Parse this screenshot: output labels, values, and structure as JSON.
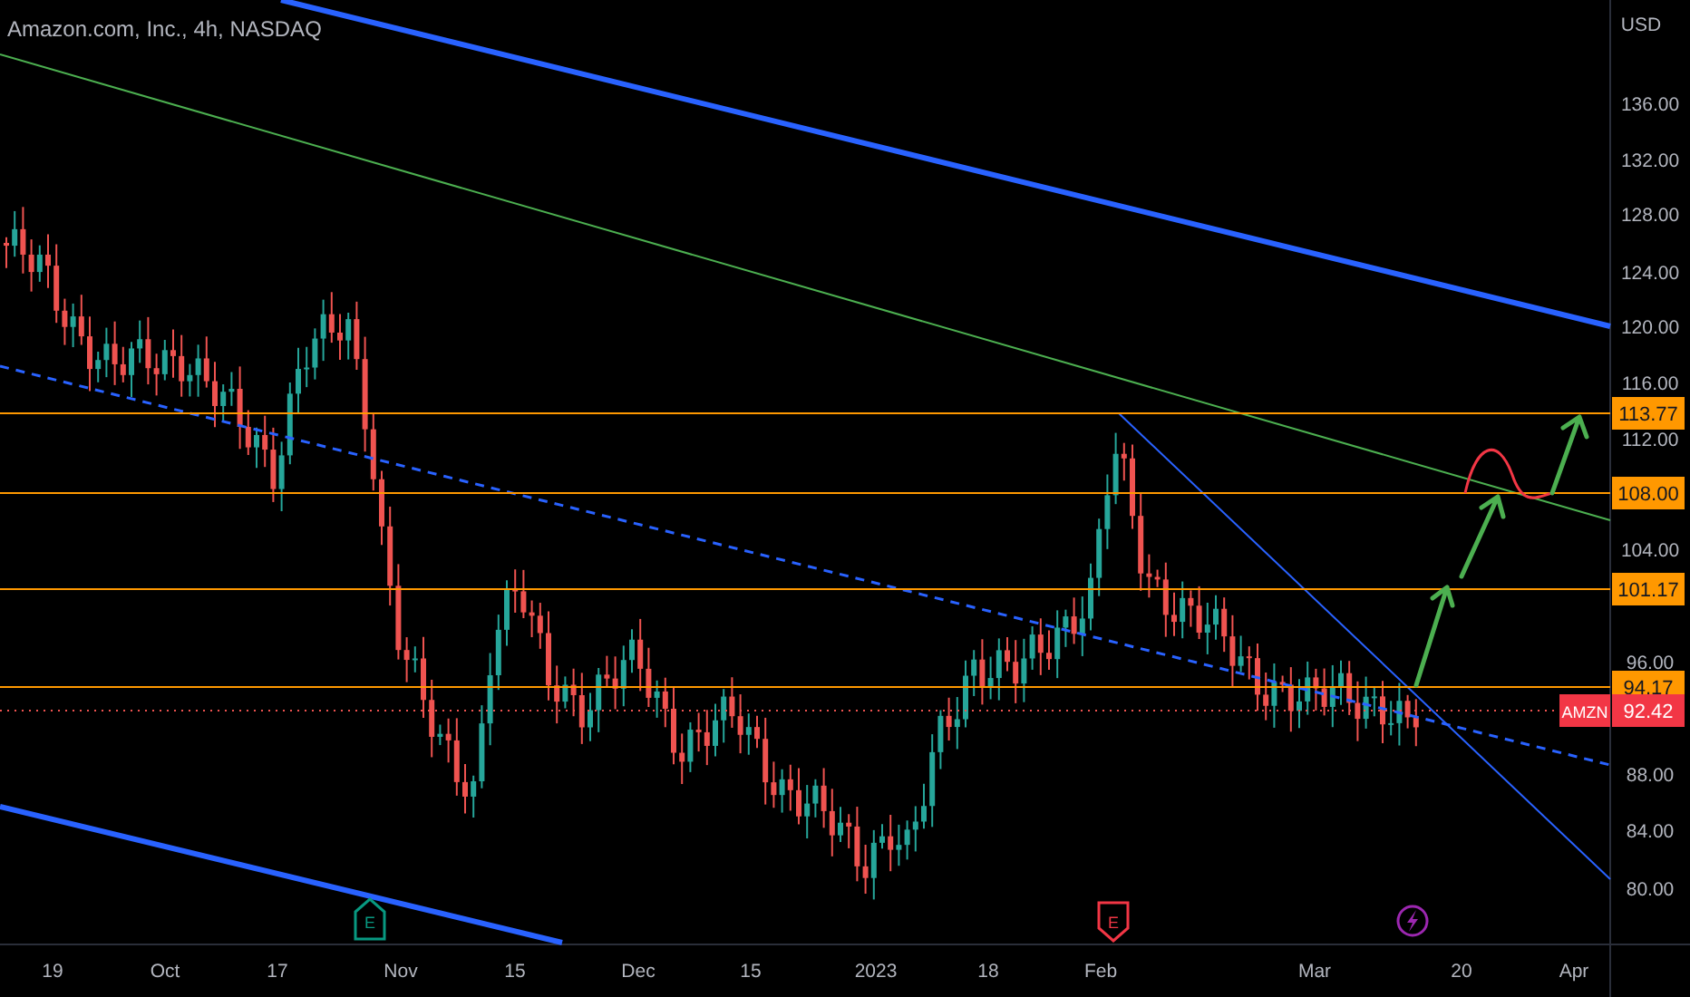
{
  "title": "Amazon.com, Inc., 4h, NASDAQ",
  "currency": "USD",
  "y_axis": [
    "136.00",
    "132.00",
    "128.00",
    "124.00",
    "120.00",
    "116.00",
    "112.00",
    "104.00",
    "96.00",
    "88.00",
    "84.00",
    "80.00"
  ],
  "x_axis": [
    "19",
    "Oct",
    "17",
    "Nov",
    "15",
    "Dec",
    "15",
    "2023",
    "18",
    "Feb",
    "Mar",
    "20",
    "Apr"
  ],
  "price_levels": [
    {
      "label": "113.77"
    },
    {
      "label": "108.00"
    },
    {
      "label": "101.17"
    },
    {
      "label": "94.17"
    }
  ],
  "current_price": {
    "symbol": "AMZN",
    "price": "92.42"
  },
  "events": [
    {
      "kind": "earnings",
      "label": "E",
      "color": "#089981"
    },
    {
      "kind": "earnings",
      "label": "E",
      "color": "#f23645"
    },
    {
      "kind": "bolt",
      "color": "#9c27b0"
    }
  ]
}
